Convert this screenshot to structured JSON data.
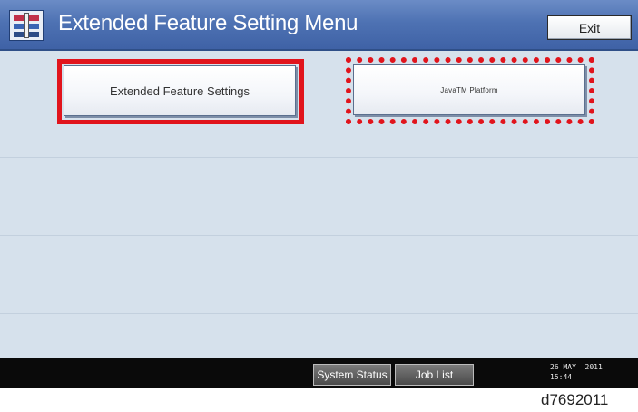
{
  "window": {
    "title": "Extended Feature Setting Menu",
    "icon": "extended-feature-settings-icon",
    "exit_label": "Exit"
  },
  "buttons": {
    "extended_feature_settings": "Extended Feature Settings",
    "java_platform": "JavaTM Platform"
  },
  "highlights": {
    "solid_frame_color": "#e1141c",
    "dotted_frame_color": "#e1141c"
  },
  "status_bar": {
    "system_status_label": "System Status",
    "job_list_label": "Job List",
    "date": "26 MAY  2011",
    "time": "15:44"
  },
  "caption": "d7692011"
}
